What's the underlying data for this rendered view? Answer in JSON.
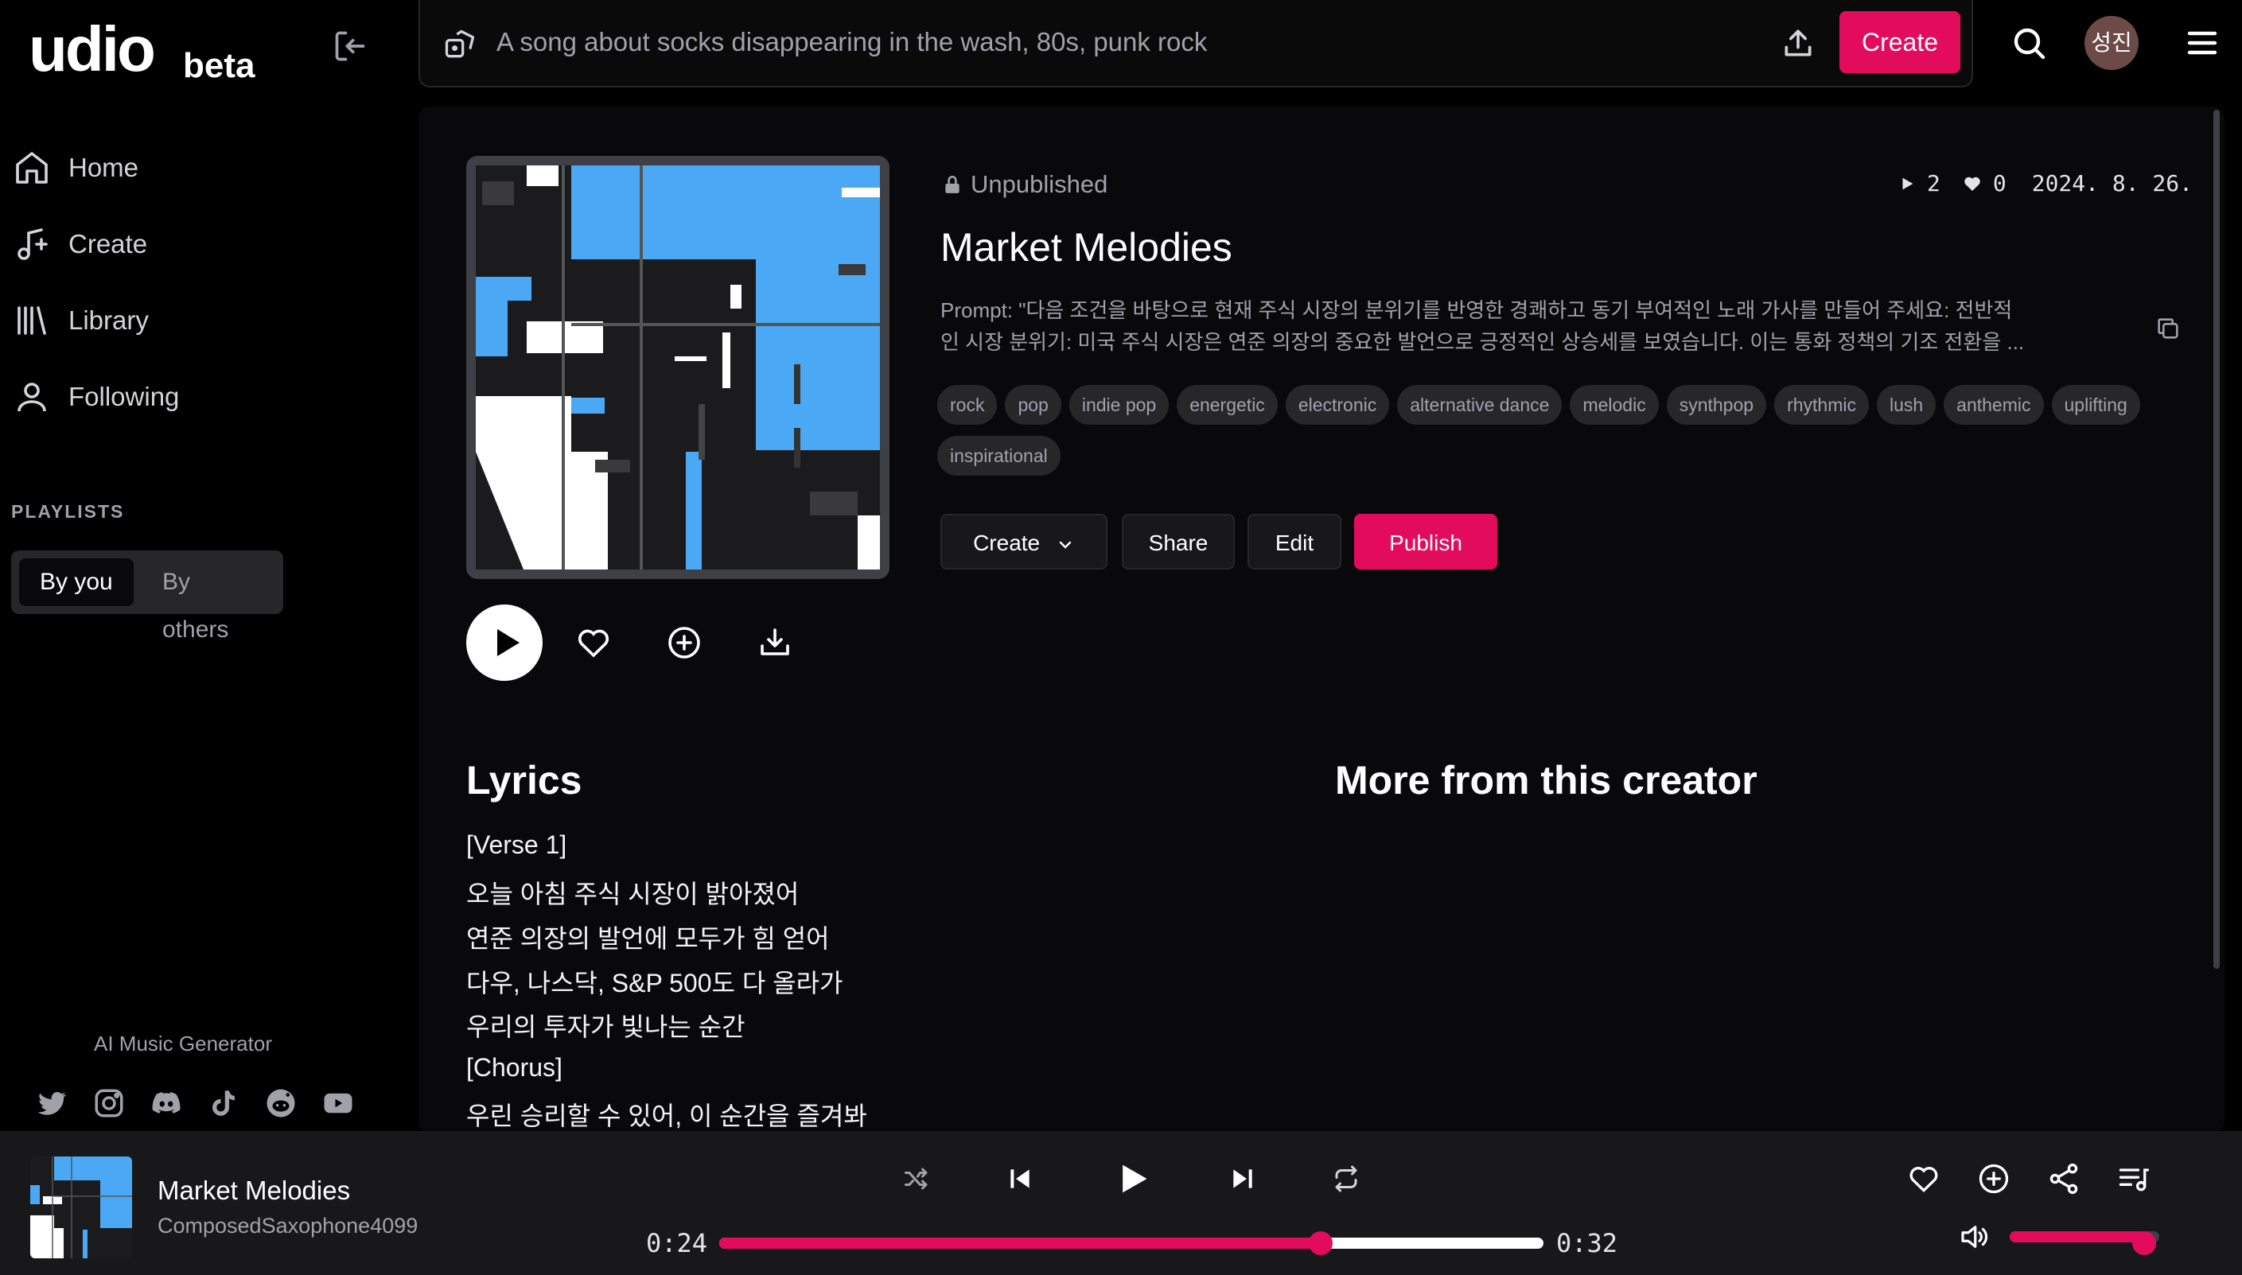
{
  "app": {
    "logo": "udio",
    "badge": "beta"
  },
  "sidebar": {
    "items": [
      {
        "label": "Home",
        "icon": "home-icon"
      },
      {
        "label": "Create",
        "icon": "music-plus-icon"
      },
      {
        "label": "Library",
        "icon": "library-icon"
      },
      {
        "label": "Following",
        "icon": "user-icon"
      }
    ],
    "playlists_label": "PLAYLISTS",
    "segment": {
      "by_you": "By you",
      "by_others": "By others",
      "selected": "By you"
    },
    "tagline": "AI Music Generator",
    "socials": [
      "twitter-icon",
      "instagram-icon",
      "discord-icon",
      "tiktok-icon",
      "reddit-icon",
      "youtube-icon"
    ]
  },
  "topbar": {
    "search_placeholder": "A song about socks disappearing in the wash, 80s, punk rock",
    "create_label": "Create",
    "avatar_text": "성진"
  },
  "song": {
    "status": "Unpublished",
    "plays": "2",
    "likes": "0",
    "date": "2024. 8. 26.",
    "title": "Market Melodies",
    "prompt_line1": "Prompt: \"다음 조건을 바탕으로 현재 주식 시장의 분위기를 반영한 경쾌하고 동기 부여적인 노래 가사를 만들어 주세요: 전반적",
    "prompt_line2": "인 시장 분위기: 미국 주식 시장은 연준 의장의 중요한 발언으로 긍정적인 상승세를 보였습니다. 이는 통화 정책의 기조 전환을 ...",
    "tags": [
      "rock",
      "pop",
      "indie pop",
      "energetic",
      "electronic",
      "alternative dance",
      "melodic",
      "synthpop",
      "rhythmic",
      "lush",
      "anthemic",
      "uplifting",
      "inspirational"
    ],
    "buttons": {
      "create": "Create",
      "share": "Share",
      "edit": "Edit",
      "publish": "Publish"
    }
  },
  "lyrics": {
    "heading": "Lyrics",
    "lines": [
      "[Verse 1]",
      "오늘 아침 주식 시장이 밝아졌어",
      "연준 의장의 발언에 모두가 힘 얻어",
      "다우, 나스닥, S&P 500도 다 올라가",
      "우리의 투자가 빛나는 순간",
      "[Chorus]",
      "우린 승리할 수 있어, 이 순간을 즐겨봐"
    ]
  },
  "more_heading": "More from this creator",
  "player": {
    "title": "Market Melodies",
    "artist": "ComposedSaxophone4099",
    "elapsed": "0:24",
    "duration": "0:32",
    "progress": 0.73,
    "volume": 0.9
  },
  "colors": {
    "accent": "#e30b5c",
    "art_blue": "#4aa8f5",
    "panel": "#09090b",
    "tag_bg": "#27272a"
  }
}
